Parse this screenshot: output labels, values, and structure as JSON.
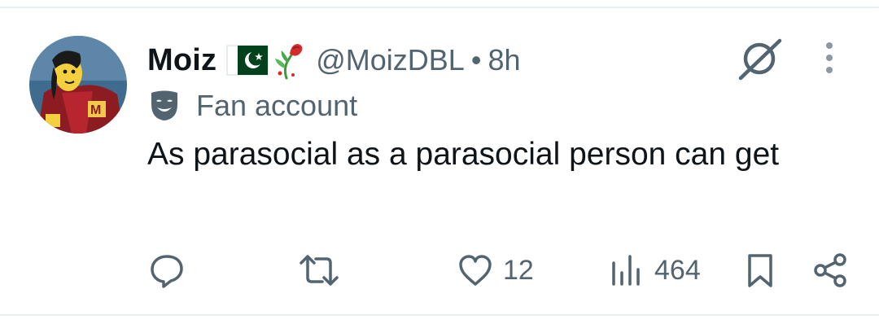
{
  "tweet": {
    "author": {
      "display_name": "Moiz",
      "handle": "@MoizDBL",
      "emojis": [
        "pakistan-flag",
        "wilted-rose"
      ]
    },
    "separator": "•",
    "timestamp": "8h",
    "label": {
      "icon": "theater-mask-icon",
      "text": "Fan account"
    },
    "text": "As parasocial as a parasocial person can get",
    "actions": {
      "reply": {
        "icon": "reply-icon",
        "count": ""
      },
      "retweet": {
        "icon": "retweet-icon",
        "count": ""
      },
      "like": {
        "icon": "heart-icon",
        "count": "12"
      },
      "views": {
        "icon": "views-bar-icon",
        "count": "464"
      },
      "bookmark": {
        "icon": "bookmark-icon"
      },
      "share": {
        "icon": "share-icon"
      }
    },
    "top_right": {
      "grok": {
        "icon": "grok-icon"
      },
      "more": {
        "icon": "more-vertical-icon"
      }
    }
  },
  "colors": {
    "text_primary": "#0f1419",
    "text_secondary": "#536471",
    "divider": "#e9eef0",
    "pakistan_green": "#01411c",
    "rose_red": "#d62b2b"
  }
}
